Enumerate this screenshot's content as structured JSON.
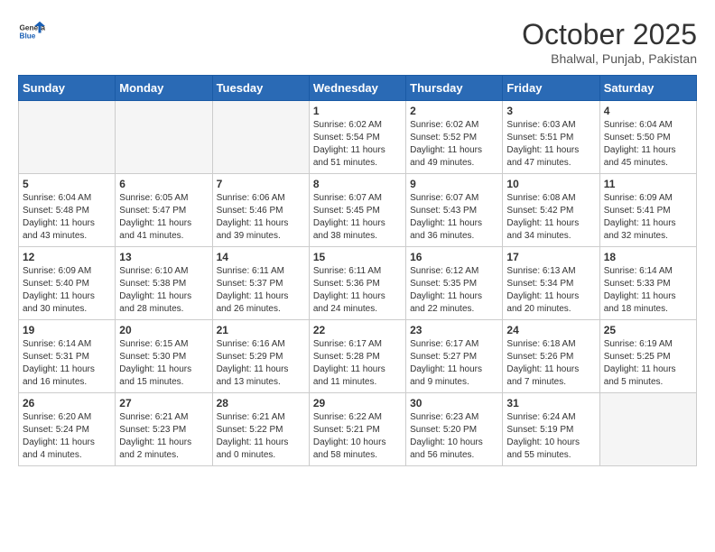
{
  "header": {
    "logo": {
      "general": "General",
      "blue": "Blue"
    },
    "title": "October 2025",
    "location": "Bhalwal, Punjab, Pakistan"
  },
  "weekdays": [
    "Sunday",
    "Monday",
    "Tuesday",
    "Wednesday",
    "Thursday",
    "Friday",
    "Saturday"
  ],
  "weeks": [
    [
      {
        "day": "",
        "info": ""
      },
      {
        "day": "",
        "info": ""
      },
      {
        "day": "",
        "info": ""
      },
      {
        "day": "1",
        "sunrise": "Sunrise: 6:02 AM",
        "sunset": "Sunset: 5:54 PM",
        "daylight": "Daylight: 11 hours and 51 minutes."
      },
      {
        "day": "2",
        "sunrise": "Sunrise: 6:02 AM",
        "sunset": "Sunset: 5:52 PM",
        "daylight": "Daylight: 11 hours and 49 minutes."
      },
      {
        "day": "3",
        "sunrise": "Sunrise: 6:03 AM",
        "sunset": "Sunset: 5:51 PM",
        "daylight": "Daylight: 11 hours and 47 minutes."
      },
      {
        "day": "4",
        "sunrise": "Sunrise: 6:04 AM",
        "sunset": "Sunset: 5:50 PM",
        "daylight": "Daylight: 11 hours and 45 minutes."
      }
    ],
    [
      {
        "day": "5",
        "sunrise": "Sunrise: 6:04 AM",
        "sunset": "Sunset: 5:48 PM",
        "daylight": "Daylight: 11 hours and 43 minutes."
      },
      {
        "day": "6",
        "sunrise": "Sunrise: 6:05 AM",
        "sunset": "Sunset: 5:47 PM",
        "daylight": "Daylight: 11 hours and 41 minutes."
      },
      {
        "day": "7",
        "sunrise": "Sunrise: 6:06 AM",
        "sunset": "Sunset: 5:46 PM",
        "daylight": "Daylight: 11 hours and 39 minutes."
      },
      {
        "day": "8",
        "sunrise": "Sunrise: 6:07 AM",
        "sunset": "Sunset: 5:45 PM",
        "daylight": "Daylight: 11 hours and 38 minutes."
      },
      {
        "day": "9",
        "sunrise": "Sunrise: 6:07 AM",
        "sunset": "Sunset: 5:43 PM",
        "daylight": "Daylight: 11 hours and 36 minutes."
      },
      {
        "day": "10",
        "sunrise": "Sunrise: 6:08 AM",
        "sunset": "Sunset: 5:42 PM",
        "daylight": "Daylight: 11 hours and 34 minutes."
      },
      {
        "day": "11",
        "sunrise": "Sunrise: 6:09 AM",
        "sunset": "Sunset: 5:41 PM",
        "daylight": "Daylight: 11 hours and 32 minutes."
      }
    ],
    [
      {
        "day": "12",
        "sunrise": "Sunrise: 6:09 AM",
        "sunset": "Sunset: 5:40 PM",
        "daylight": "Daylight: 11 hours and 30 minutes."
      },
      {
        "day": "13",
        "sunrise": "Sunrise: 6:10 AM",
        "sunset": "Sunset: 5:38 PM",
        "daylight": "Daylight: 11 hours and 28 minutes."
      },
      {
        "day": "14",
        "sunrise": "Sunrise: 6:11 AM",
        "sunset": "Sunset: 5:37 PM",
        "daylight": "Daylight: 11 hours and 26 minutes."
      },
      {
        "day": "15",
        "sunrise": "Sunrise: 6:11 AM",
        "sunset": "Sunset: 5:36 PM",
        "daylight": "Daylight: 11 hours and 24 minutes."
      },
      {
        "day": "16",
        "sunrise": "Sunrise: 6:12 AM",
        "sunset": "Sunset: 5:35 PM",
        "daylight": "Daylight: 11 hours and 22 minutes."
      },
      {
        "day": "17",
        "sunrise": "Sunrise: 6:13 AM",
        "sunset": "Sunset: 5:34 PM",
        "daylight": "Daylight: 11 hours and 20 minutes."
      },
      {
        "day": "18",
        "sunrise": "Sunrise: 6:14 AM",
        "sunset": "Sunset: 5:33 PM",
        "daylight": "Daylight: 11 hours and 18 minutes."
      }
    ],
    [
      {
        "day": "19",
        "sunrise": "Sunrise: 6:14 AM",
        "sunset": "Sunset: 5:31 PM",
        "daylight": "Daylight: 11 hours and 16 minutes."
      },
      {
        "day": "20",
        "sunrise": "Sunrise: 6:15 AM",
        "sunset": "Sunset: 5:30 PM",
        "daylight": "Daylight: 11 hours and 15 minutes."
      },
      {
        "day": "21",
        "sunrise": "Sunrise: 6:16 AM",
        "sunset": "Sunset: 5:29 PM",
        "daylight": "Daylight: 11 hours and 13 minutes."
      },
      {
        "day": "22",
        "sunrise": "Sunrise: 6:17 AM",
        "sunset": "Sunset: 5:28 PM",
        "daylight": "Daylight: 11 hours and 11 minutes."
      },
      {
        "day": "23",
        "sunrise": "Sunrise: 6:17 AM",
        "sunset": "Sunset: 5:27 PM",
        "daylight": "Daylight: 11 hours and 9 minutes."
      },
      {
        "day": "24",
        "sunrise": "Sunrise: 6:18 AM",
        "sunset": "Sunset: 5:26 PM",
        "daylight": "Daylight: 11 hours and 7 minutes."
      },
      {
        "day": "25",
        "sunrise": "Sunrise: 6:19 AM",
        "sunset": "Sunset: 5:25 PM",
        "daylight": "Daylight: 11 hours and 5 minutes."
      }
    ],
    [
      {
        "day": "26",
        "sunrise": "Sunrise: 6:20 AM",
        "sunset": "Sunset: 5:24 PM",
        "daylight": "Daylight: 11 hours and 4 minutes."
      },
      {
        "day": "27",
        "sunrise": "Sunrise: 6:21 AM",
        "sunset": "Sunset: 5:23 PM",
        "daylight": "Daylight: 11 hours and 2 minutes."
      },
      {
        "day": "28",
        "sunrise": "Sunrise: 6:21 AM",
        "sunset": "Sunset: 5:22 PM",
        "daylight": "Daylight: 11 hours and 0 minutes."
      },
      {
        "day": "29",
        "sunrise": "Sunrise: 6:22 AM",
        "sunset": "Sunset: 5:21 PM",
        "daylight": "Daylight: 10 hours and 58 minutes."
      },
      {
        "day": "30",
        "sunrise": "Sunrise: 6:23 AM",
        "sunset": "Sunset: 5:20 PM",
        "daylight": "Daylight: 10 hours and 56 minutes."
      },
      {
        "day": "31",
        "sunrise": "Sunrise: 6:24 AM",
        "sunset": "Sunset: 5:19 PM",
        "daylight": "Daylight: 10 hours and 55 minutes."
      },
      {
        "day": "",
        "info": ""
      }
    ]
  ]
}
